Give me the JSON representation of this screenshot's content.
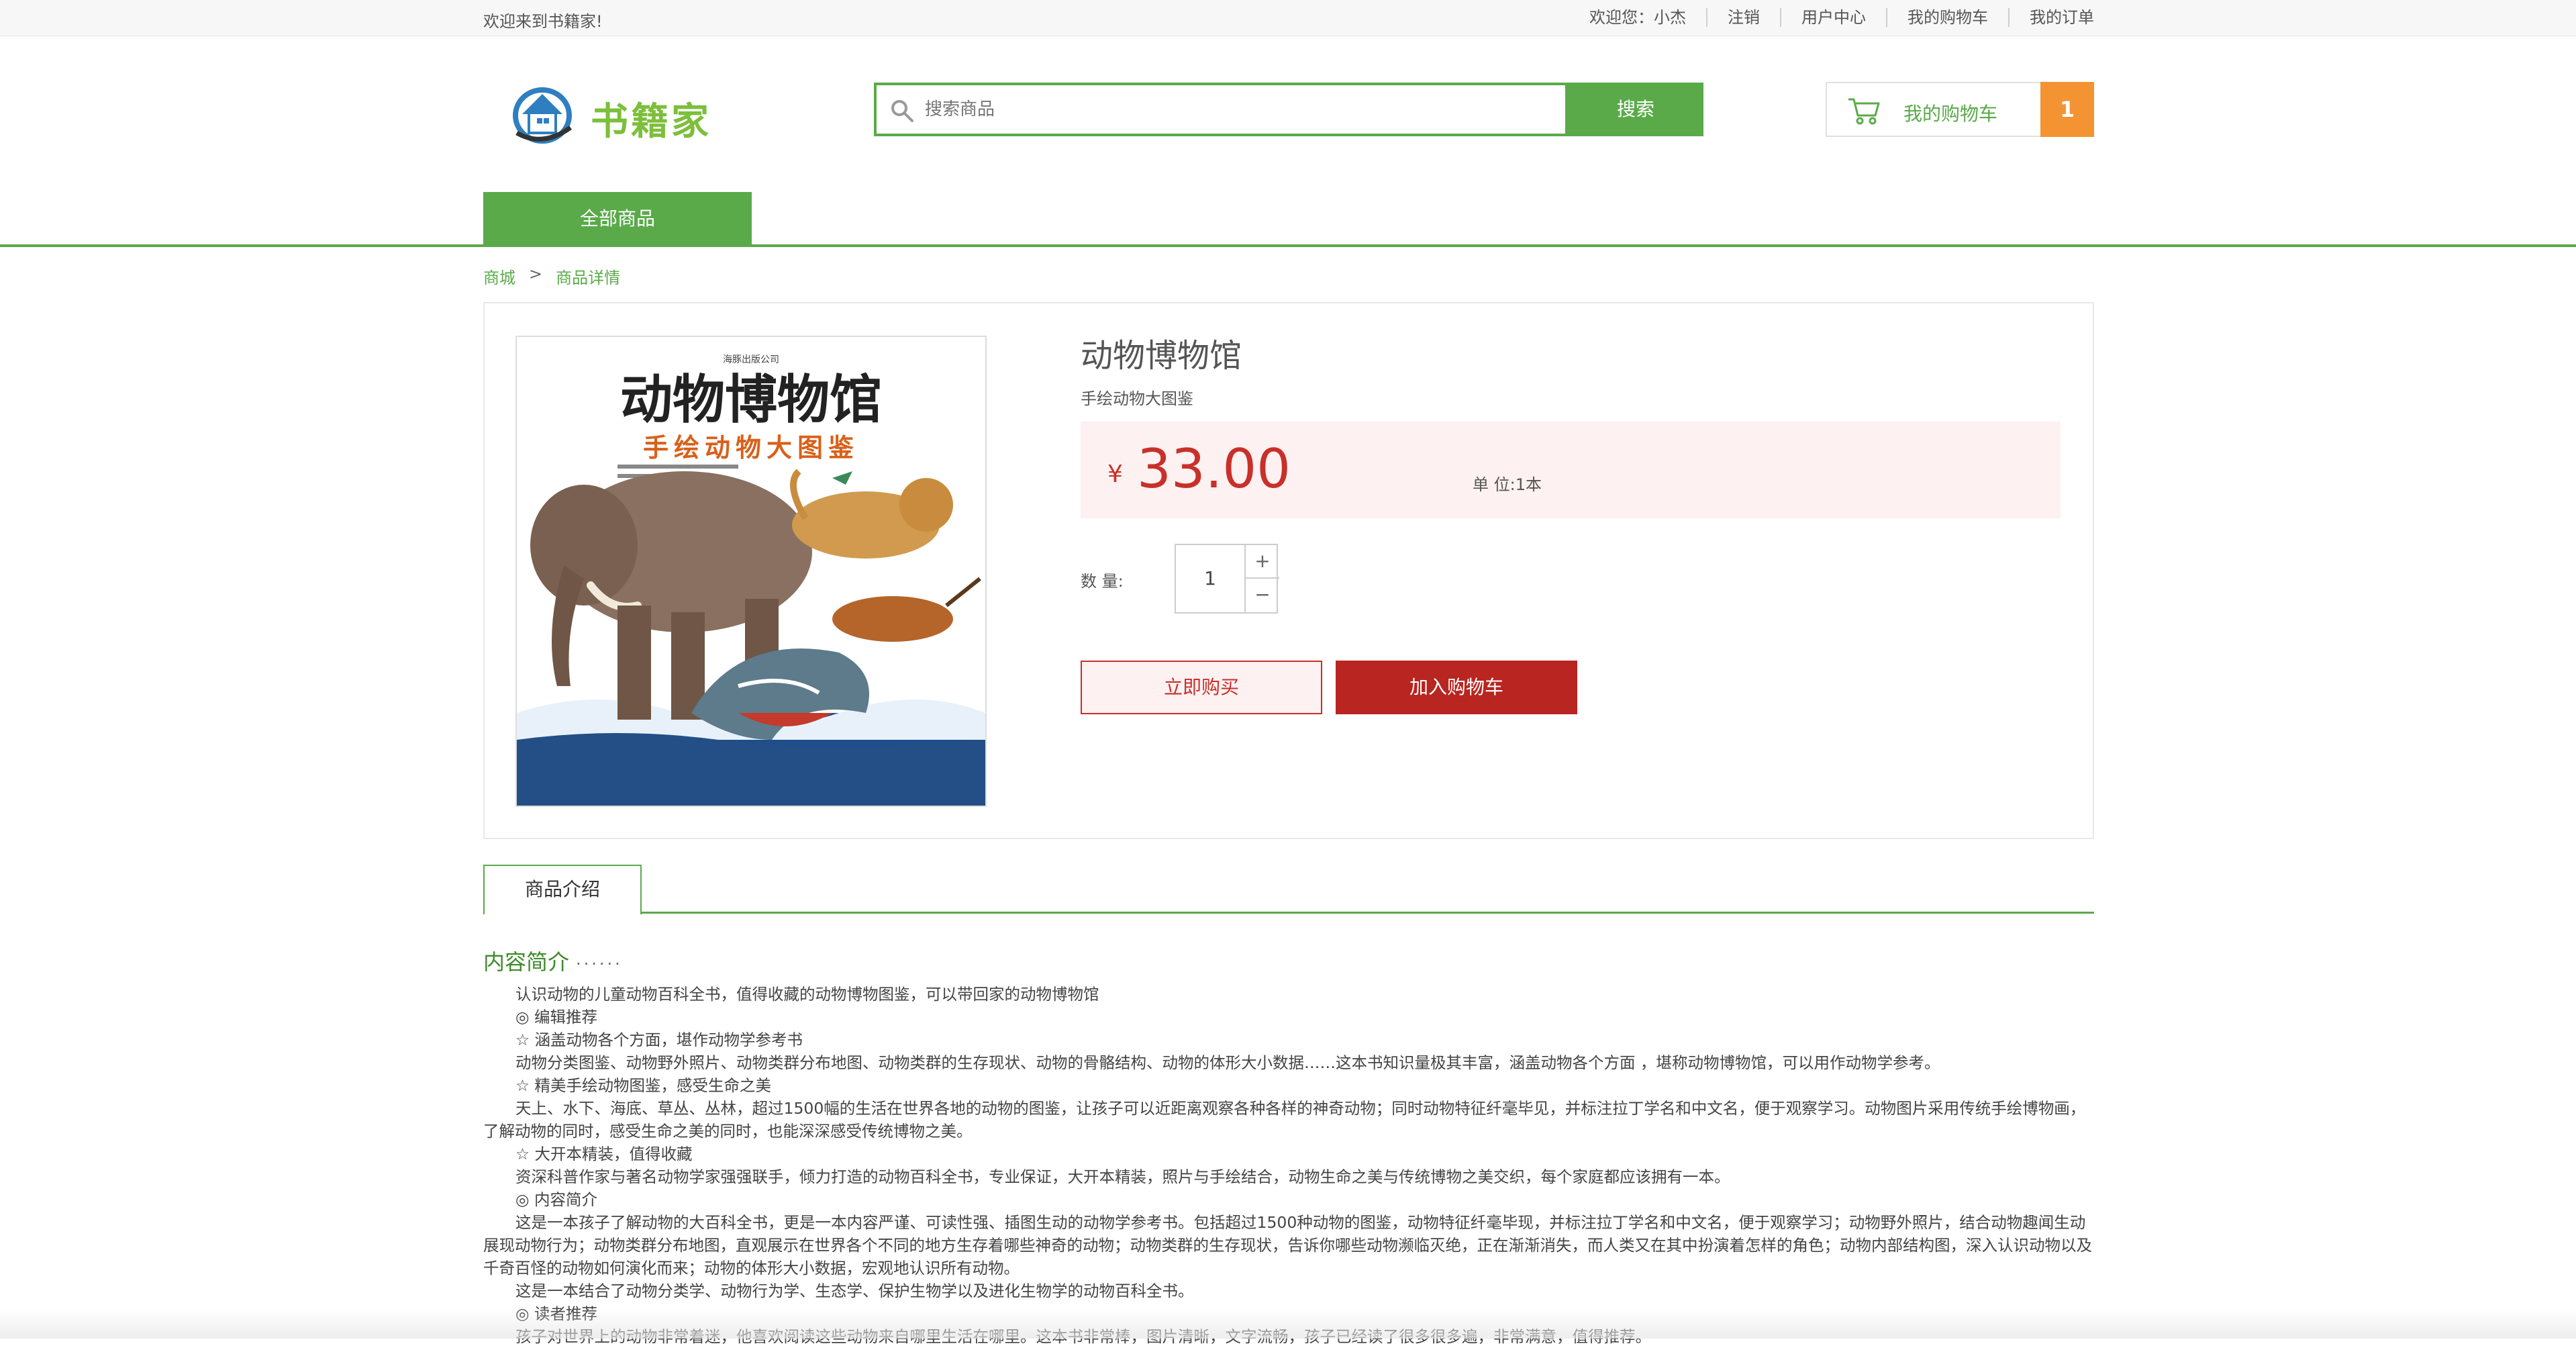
{
  "topbar": {
    "welcome": "欢迎来到书籍家!",
    "links": [
      "欢迎您：小杰",
      "注销",
      "用户中心",
      "我的购物车",
      "我的订单"
    ]
  },
  "header": {
    "logo_text": "书籍家",
    "search_placeholder": "搜索商品",
    "search_button": "搜索",
    "cart_label": "我的购物车",
    "cart_count": "1"
  },
  "nav": {
    "all_products": "全部商品"
  },
  "breadcrumb": {
    "home": "商城",
    "sep": ">",
    "current": "商品详情"
  },
  "product": {
    "cover": {
      "publisher": "海豚出版公司",
      "title": "动物博物馆",
      "subtitle": "手绘动物大图鉴"
    },
    "title": "动物博物馆",
    "subtitle": "手绘动物大图鉴",
    "currency": "¥",
    "price": "33.00",
    "unit": "单 位:1本",
    "qty_label": "数 量:",
    "qty": "1",
    "qty_plus": "+",
    "qty_minus": "−",
    "buy_now": "立即购买",
    "add_to_cart": "加入购物车"
  },
  "tabs": {
    "intro": "商品介绍"
  },
  "description": {
    "heading": "内容简介",
    "heading_dots": "······",
    "paragraphs": [
      "认识动物的儿童动物百科全书，值得收藏的动物博物图鉴，可以带回家的动物博物馆",
      "◎ 编辑推荐",
      "☆ 涵盖动物各个方面，堪作动物学参考书",
      "动物分类图鉴、动物野外照片、动物类群分布地图、动物类群的生存现状、动物的骨骼结构、动物的体形大小数据……这本书知识量极其丰富，涵盖动物各个方面 ，堪称动物博物馆，可以用作动物学参考。",
      "☆ 精美手绘动物图鉴，感受生命之美",
      "天上、水下、海底、草丛、丛林，超过1500幅的生活在世界各地的动物的图鉴，让孩子可以近距离观察各种各样的神奇动物；同时动物特征纤毫毕见，并标注拉丁学名和中文名，便于观察学习。动物图片采用传统手绘博物画，了解动物的同时，感受生命之美的同时，也能深深感受传统博物之美。",
      "☆ 大开本精装，值得收藏",
      "资深科普作家与著名动物学家强强联手，倾力打造的动物百科全书，专业保证，大开本精装，照片与手绘结合，动物生命之美与传统博物之美交织，每个家庭都应该拥有一本。",
      "◎ 内容简介",
      "这是一本孩子了解动物的大百科全书，更是一本内容严谨、可读性强、插图生动的动物学参考书。包括超过1500种动物的图鉴，动物特征纤毫毕现，并标注拉丁学名和中文名，便于观察学习；动物野外照片，结合动物趣闻生动展现动物行为；动物类群分布地图，直观展示在世界各个不同的地方生存着哪些神奇的动物；动物类群的生存现状，告诉你哪些动物濒临灭绝，正在渐渐消失，而人类又在其中扮演着怎样的角色；动物内部结构图，深入认识动物以及千奇百怪的动物如何演化而来；动物的体形大小数据，宏观地认识所有动物。",
      "这是一本结合了动物分类学、动物行为学、生态学、保护生物学以及进化生物学的动物百科全书。",
      "◎ 读者推荐",
      "孩子对世界上的动物非常着迷，他喜欢阅读这些动物来自哪里生活在哪里。这本书非常棒，图片清晰，文字流畅，孩子已经读了很多很多遍，非常满意，值得推荐。"
    ]
  },
  "colors": {
    "brand_green": "#5aaa4a",
    "price_red": "#c8302a",
    "cart_badge_orange": "#f39332"
  }
}
